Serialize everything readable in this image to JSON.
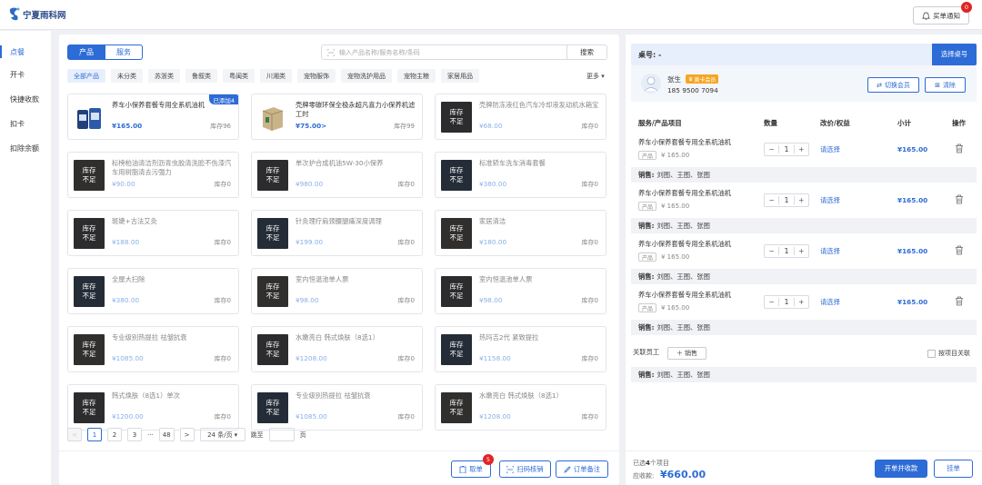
{
  "brand": {
    "name": "宁夏雨科网",
    "color": "#2d6bd6"
  },
  "topbar": {
    "notify_label": "买单通知",
    "notify_count": "0"
  },
  "sidebar": {
    "items": [
      {
        "label": "点餐",
        "active": true
      },
      {
        "label": "开卡"
      },
      {
        "label": "快捷收款"
      },
      {
        "label": "扣卡"
      },
      {
        "label": "扣除余额"
      }
    ]
  },
  "products": {
    "tabs": [
      {
        "label": "产品",
        "active": true
      },
      {
        "label": "服务"
      }
    ],
    "search_placeholder": "输入产品名称/服务名称/条码",
    "search_button": "搜索",
    "categories": [
      "全部产品",
      "未分类",
      "苏浙类",
      "鲁叙类",
      "粤闽类",
      "川湘类",
      "宠物服饰",
      "宠物洗护用品",
      "宠物主粮",
      "家居用品"
    ],
    "more_label": "更多",
    "stock_out_line1": "库存",
    "stock_out_line2": "不足",
    "items": [
      {
        "name": "养车小保养套餐专用全系机油机",
        "price": "¥165.00",
        "stock": "库存96",
        "added": "已添加4",
        "state": "ok"
      },
      {
        "name": "壳牌零碳环保全极永超凡喜力小保养机滤工时",
        "price": "¥75.00>",
        "stock": "库存99",
        "state": "ok"
      },
      {
        "name": "壳牌防冻液红色汽车冷却液发动机水箱宝",
        "price": "¥68.00",
        "stock": "库存0",
        "state": "out"
      },
      {
        "name": "标榜柏油清洁剂沥青虫胶清洗脸不伤漆汽车用树脂清去污强力",
        "price": "¥90.00",
        "stock": "库存0",
        "state": "out"
      },
      {
        "name": "单次护合成机油5W-30小保养",
        "price": "¥980.00",
        "stock": "库存0",
        "state": "out"
      },
      {
        "name": "标准轿车洗车消毒套餐",
        "price": "¥380.00",
        "stock": "库存0",
        "state": "out"
      },
      {
        "name": "斑婕+古法艾灸",
        "price": "¥188.00",
        "stock": "库存0",
        "state": "out"
      },
      {
        "name": "针灸理疗肩颈腰腿痛深度调理",
        "price": "¥199.00",
        "stock": "库存0",
        "state": "out"
      },
      {
        "name": "家居清洁",
        "price": "¥180.00",
        "stock": "库存0",
        "state": "out"
      },
      {
        "name": "全屋大扫除",
        "price": "¥380.00",
        "stock": "库存0",
        "state": "out"
      },
      {
        "name": "室内恒温池单人票",
        "price": "¥98.00",
        "stock": "库存0",
        "state": "out"
      },
      {
        "name": "室内恒温池单人票",
        "price": "¥98.00",
        "stock": "库存0",
        "state": "out"
      },
      {
        "name": "专业级别热提拉 祛皱抗衰",
        "price": "¥1085.00",
        "stock": "库存0",
        "state": "out"
      },
      {
        "name": "水嫩亮白 韩式焕肤（8选1）",
        "price": "¥1208.00",
        "stock": "库存0",
        "state": "out"
      },
      {
        "name": "热玛吉2代 紧致提拉",
        "price": "¥1158.00",
        "stock": "库存0",
        "state": "out"
      },
      {
        "name": "韩式焕肤（8选1）单次",
        "price": "¥1200.00",
        "stock": "库存0",
        "state": "out"
      },
      {
        "name": "专业级别热提拉 祛皱抗衰",
        "price": "¥1085.00",
        "stock": "库存0",
        "state": "out"
      },
      {
        "name": "水嫩亮白 韩式焕肤（8选1）",
        "price": "¥1208.00",
        "stock": "库存0",
        "state": "out"
      }
    ]
  },
  "pagination": {
    "pages": [
      "1",
      "2",
      "3"
    ],
    "ellipsis": "···",
    "last": "48",
    "page_size": "24 条/页",
    "goto_label": "跳至",
    "page_unit": "页"
  },
  "left_actions": {
    "cancel_label": "取单",
    "cancel_badge": "5",
    "scan_label": "扫码核销",
    "remark_label": "订单备注"
  },
  "order": {
    "table_label": "桌号: -",
    "choose_table": "选择桌号",
    "member": {
      "name": "张生",
      "tag": "黄卡会员",
      "phone": "185 9500 7094",
      "switch_label": "切换会员",
      "clear_label": "清除"
    },
    "headers": {
      "item": "服务/产品项目",
      "qty": "数量",
      "price": "改价/权益",
      "subtotal": "小计",
      "op": "操作"
    },
    "rows": [
      {
        "name": "养车小保养套餐专用全系机油机",
        "tag": "产品",
        "unit": "¥ 165.00",
        "qty": "1",
        "select": "请选择",
        "subtotal": "¥165.00",
        "sales_label": "销售:",
        "sales": "刘图、王图、张图"
      },
      {
        "name": "养车小保养套餐专用全系机油机",
        "tag": "产品",
        "unit": "¥ 165.00",
        "qty": "1",
        "select": "请选择",
        "subtotal": "¥165.00",
        "sales_label": "销售:",
        "sales": "刘图、王图、张图"
      },
      {
        "name": "养车小保养套餐专用全系机油机",
        "tag": "产品",
        "unit": "¥ 165.00",
        "qty": "1",
        "select": "请选择",
        "subtotal": "¥165.00",
        "sales_label": "销售:",
        "sales": "刘图、王图、张图"
      },
      {
        "name": "养车小保养套餐专用全系机油机",
        "tag": "产品",
        "unit": "¥ 165.00",
        "qty": "1",
        "select": "请选择",
        "subtotal": "¥165.00",
        "sales_label": "销售:",
        "sales": "刘图、王图、张图"
      }
    ],
    "staff_label": "关联员工",
    "add_sales": "销售",
    "by_item_label": "按项目关联",
    "staff_sales_label": "销售:",
    "staff_sales": "刘图、王图、张图",
    "selected_prefix": "已选",
    "selected_count": "4",
    "selected_suffix": "个项目",
    "due_label": "应收款:",
    "due_amount": "¥660.00",
    "checkout": "开单并收款",
    "hang": "挂单"
  }
}
